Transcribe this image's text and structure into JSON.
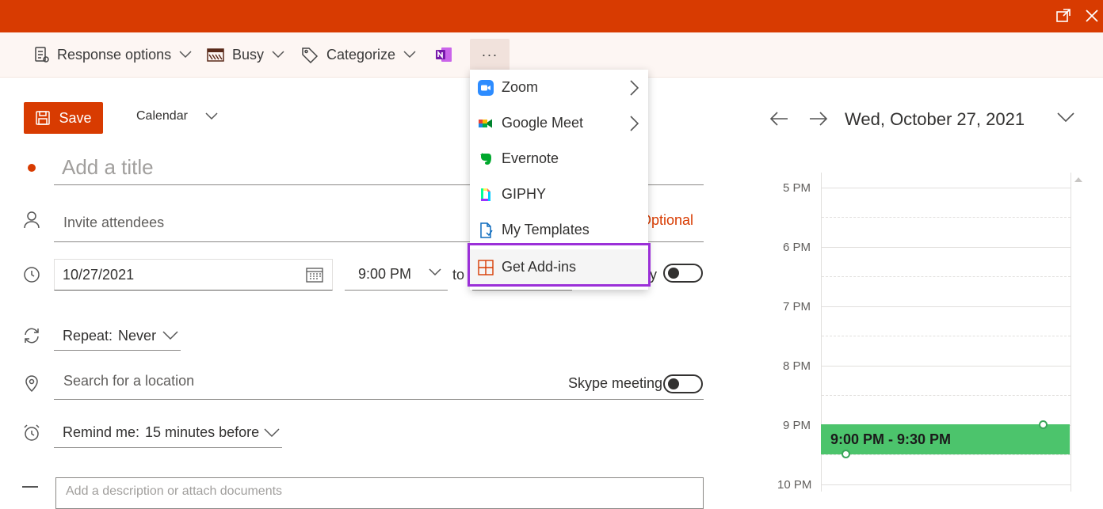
{
  "toolbar": {
    "response_options": "Response options",
    "busy": "Busy",
    "categorize": "Categorize",
    "more": "···"
  },
  "form": {
    "save_label": "Save",
    "calendar_label": "Calendar",
    "title_placeholder": "Add a title",
    "attendees_placeholder": "Invite attendees",
    "optional_label": "Optional",
    "date_value": "10/27/2021",
    "start_time": "9:00 PM",
    "to_label": "to",
    "all_day_partial": "y",
    "repeat_label": "Repeat:",
    "repeat_value": "Never",
    "location_placeholder": "Search for a location",
    "skype_label": "Skype meeting",
    "remind_label": "Remind me:",
    "remind_value": "15 minutes before",
    "description_placeholder": "Add a description or attach documents"
  },
  "menu": {
    "items": [
      {
        "label": "Zoom",
        "icon": "zoom-icon",
        "submenu": true
      },
      {
        "label": "Google Meet",
        "icon": "google-meet-icon",
        "submenu": true
      },
      {
        "label": "Evernote",
        "icon": "evernote-icon",
        "submenu": false
      },
      {
        "label": "GIPHY",
        "icon": "giphy-icon",
        "submenu": false
      },
      {
        "label": "My Templates",
        "icon": "templates-icon",
        "submenu": false
      },
      {
        "label": "Get Add-ins",
        "icon": "add-ins-icon",
        "submenu": false
      }
    ],
    "highlight_color": "#9b30d8"
  },
  "calendar": {
    "date_title": "Wed, October 27, 2021",
    "hours": [
      "5 PM",
      "6 PM",
      "7 PM",
      "8 PM",
      "9 PM",
      "10 PM"
    ],
    "event_label": "9:00 PM - 9:30 PM",
    "event_color": "#4cc46c"
  },
  "colors": {
    "accent": "#d83b01",
    "toolbar_bg": "#fdf6f3"
  }
}
